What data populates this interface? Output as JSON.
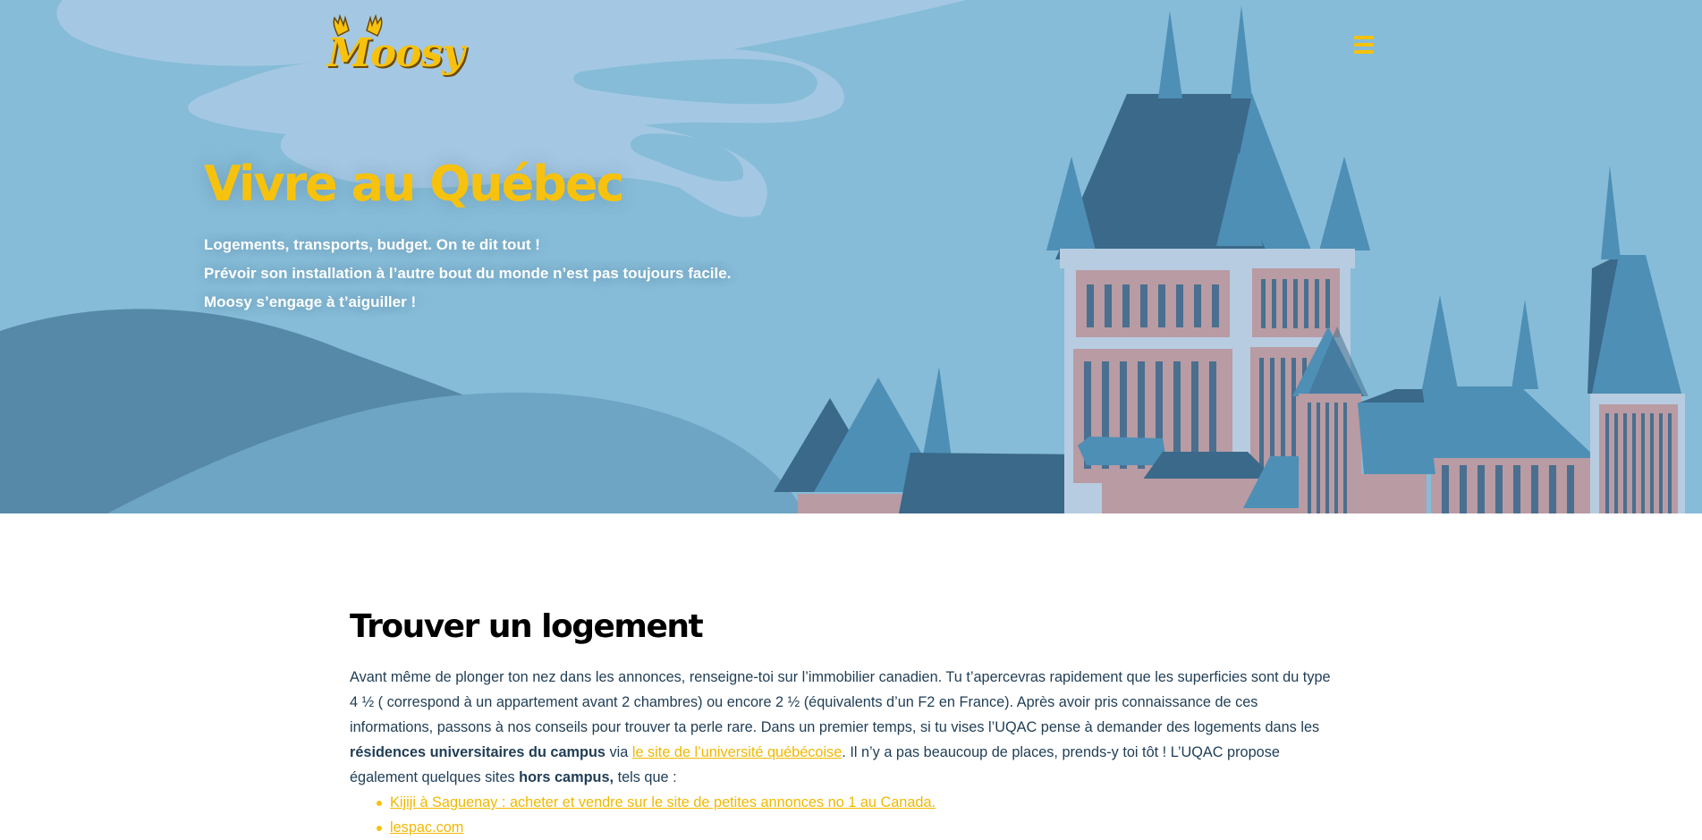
{
  "header": {
    "logo_text": "Moosy",
    "menu_icon": "hamburger-icon"
  },
  "hero": {
    "title": "Vivre au Québec",
    "lines": [
      "Logements, transports, budget. On te dit tout !",
      "Prévoir son installation à l’autre bout du monde n’est pas toujours facile.",
      "Moosy s’engage à  t’aiguiller !"
    ]
  },
  "section": {
    "title": "Trouver un logement",
    "para_part1": "Avant même de plonger ton nez dans les annonces, renseigne-toi sur l’immobilier canadien. Tu t’apercevras rapidement que les superficies sont du type 4 ½ ( correspond à un appartement avant 2 chambres) ou encore 2 ½ (équivalents d’un F2 en France). Après avoir pris connaissance de ces informations, passons à nos conseils pour trouver ta perle rare. Dans un premier temps, si tu vises l’UQAC pense à demander des logements dans les ",
    "para_bold1": "résidences universitaires du campus",
    "para_part2": " via ",
    "para_link": "le site de l’université québécoise",
    "para_part3": ". Il n’y a pas beaucoup de places, prends-y toi tôt ! L’UQAC propose également quelques sites ",
    "para_bold2": "hors campus,",
    "para_part4": " tels que :",
    "links": [
      "Kijiji à Saguenay : acheter et vendre sur le site de petites annonces no 1 au Canada.",
      "lespac.com"
    ]
  },
  "colors": {
    "sky": "#86bcd8",
    "accent_yellow": "#f7c20e",
    "text_dark": "#1f3d55",
    "roof_dark": "#3b6989",
    "roof_light": "#4e8fb6",
    "wall_pink": "#b89ba3",
    "wall_light": "#b7cce0"
  }
}
